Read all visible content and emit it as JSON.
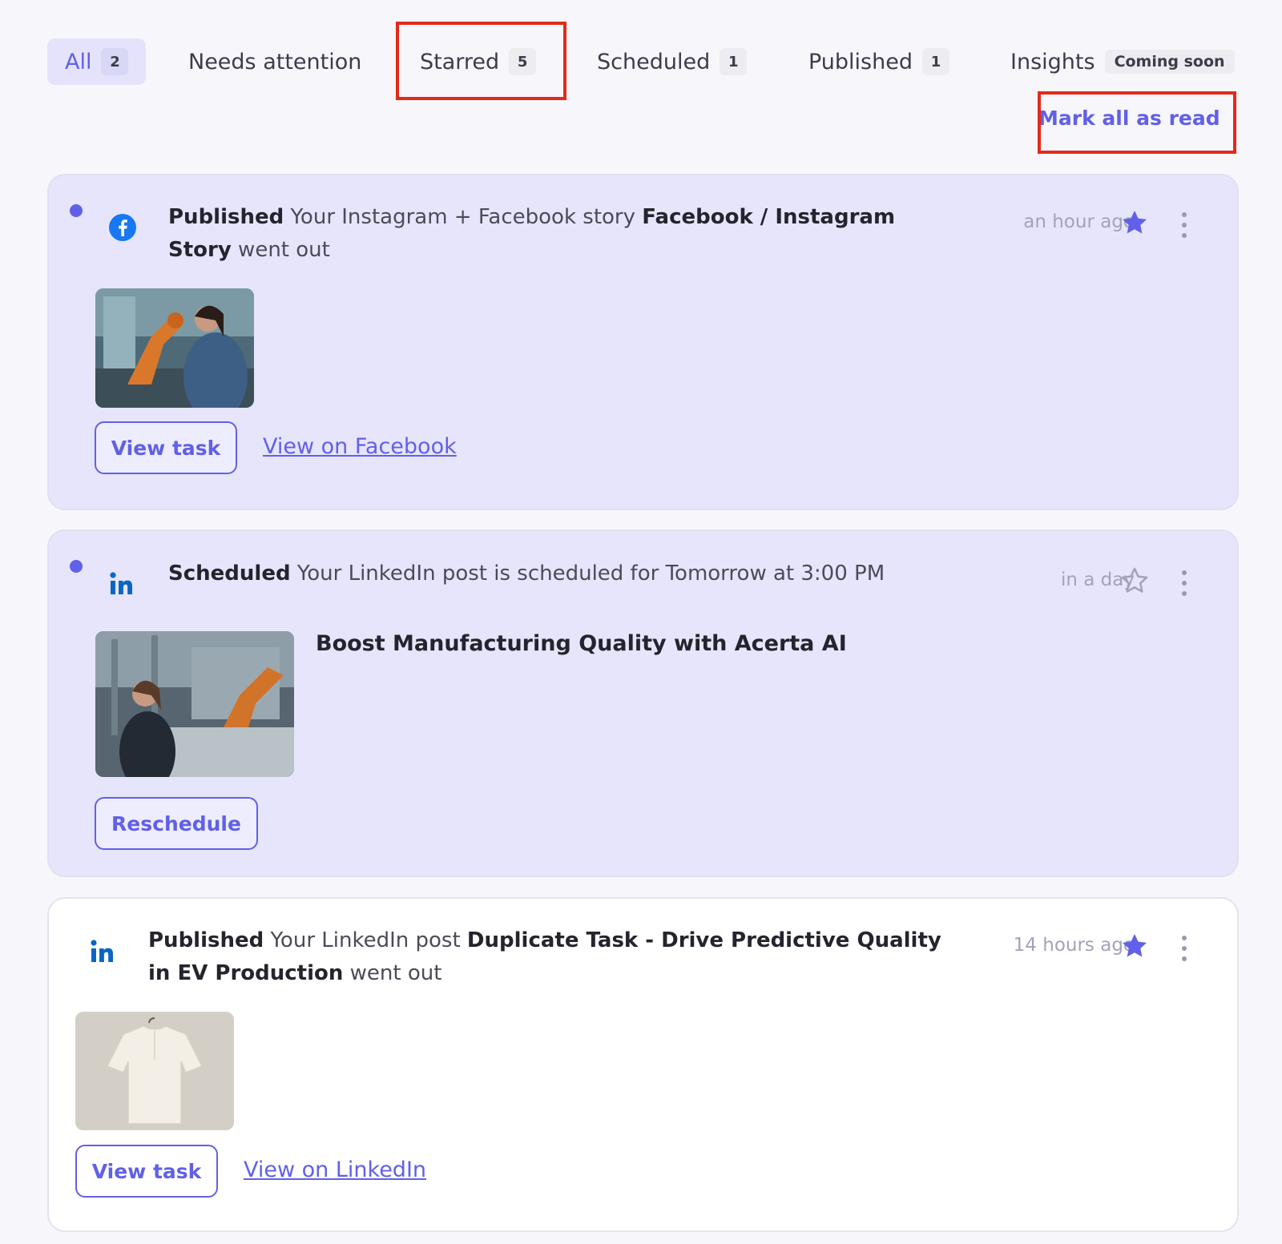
{
  "tabs": [
    {
      "label": "All",
      "count": "2"
    },
    {
      "label": "Needs attention"
    },
    {
      "label": "Starred",
      "count": "5"
    },
    {
      "label": "Scheduled",
      "count": "1"
    },
    {
      "label": "Published",
      "count": "1"
    },
    {
      "label": "Insights",
      "badge": "Coming soon"
    }
  ],
  "header": {
    "mark_all_read": "Mark all as read"
  },
  "colors": {
    "accent": "#6160e8",
    "unread_card": "#e6e5fc",
    "highlight": "#e32a1b",
    "facebook": "#1877f2",
    "linkedin": "#0a66c2"
  },
  "notifications": [
    {
      "network_icon": "facebook-icon",
      "status": "Published",
      "text1": " Your Instagram + Facebook story ",
      "name": "Facebook / Instagram Story",
      "text2": " went out",
      "time": "an hour ago",
      "starred": true,
      "unread": true,
      "image": "factory worker with robotic arm",
      "primary_button": "View task",
      "link": "View on Facebook"
    },
    {
      "network_icon": "linkedin-icon",
      "status": "Scheduled",
      "text1": " Your LinkedIn post is scheduled for Tomorrow at 3:00 PM",
      "time": "in a day",
      "starred": false,
      "unread": true,
      "image": "engineer with tablet in robotic factory",
      "post_title": "Boost Manufacturing Quality with Acerta AI",
      "primary_button": "Reschedule"
    },
    {
      "network_icon": "linkedin-icon",
      "status": "Published",
      "text1": " Your LinkedIn post ",
      "name": "Duplicate Task - Drive Predictive Quality in EV Production",
      "text2": " went out",
      "time": "14 hours ago",
      "starred": true,
      "unread": false,
      "image": "white shirt on hanger",
      "primary_button": "View task",
      "link": "View on LinkedIn"
    }
  ]
}
